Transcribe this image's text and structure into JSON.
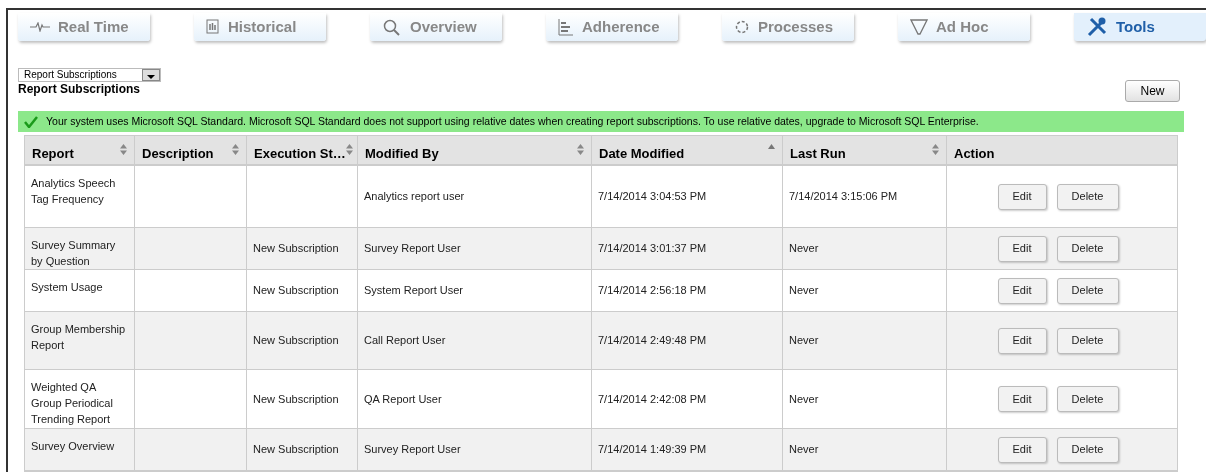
{
  "tabs": [
    {
      "label": "Real Time",
      "selected": false
    },
    {
      "label": "Historical",
      "selected": false
    },
    {
      "label": "Overview",
      "selected": false
    },
    {
      "label": "Adherence",
      "selected": false
    },
    {
      "label": "Processes",
      "selected": false
    },
    {
      "label": "Ad Hoc",
      "selected": false
    },
    {
      "label": "Tools",
      "selected": true
    }
  ],
  "view_select": {
    "value": "Report Subscriptions"
  },
  "page_title": "Report Subscriptions",
  "new_button": "New",
  "banner": {
    "text": "Your system uses Microsoft SQL Standard. Microsoft SQL Standard does not support using relative dates when creating report subscriptions. To use relative dates, upgrade to Microsoft SQL Enterprise."
  },
  "table": {
    "columns": [
      {
        "label": "Report",
        "sortable": true,
        "sorted": false
      },
      {
        "label": "Description",
        "sortable": true,
        "sorted": false
      },
      {
        "label": "Execution St…",
        "sortable": true,
        "sorted": false
      },
      {
        "label": "Modified By",
        "sortable": true,
        "sorted": false
      },
      {
        "label": "Date Modified",
        "sortable": true,
        "sorted": true
      },
      {
        "label": "Last Run",
        "sortable": true,
        "sorted": false
      },
      {
        "label": "Action",
        "sortable": false,
        "sorted": false
      }
    ],
    "rows": [
      {
        "report": "Analytics Speech Tag Frequency",
        "modified_by": "Analytics report user",
        "date_modified": "7/14/2014 3:04:53 PM",
        "last_run": "7/14/2014 3:15:06 PM",
        "actions": [
          "Edit",
          "Delete"
        ]
      },
      {
        "report": "Survey Summary by Question",
        "execution": "New Subscription",
        "modified_by": "Survey Report User",
        "date_modified": "7/14/2014 3:01:37 PM",
        "last_run": "Never",
        "actions": [
          "Edit",
          "Delete"
        ]
      },
      {
        "report": "System Usage",
        "execution": "New Subscription",
        "modified_by": "System Report User",
        "date_modified": "7/14/2014 2:56:18 PM",
        "last_run": "Never",
        "actions": [
          "Edit",
          "Delete"
        ]
      },
      {
        "report": "Group Membership Report",
        "execution": "New Subscription",
        "modified_by": "Call Report User",
        "date_modified": "7/14/2014 2:49:48 PM",
        "last_run": "Never",
        "actions": [
          "Edit",
          "Delete"
        ]
      },
      {
        "report": "Weighted QA Group Periodical Trending Report",
        "execution": "New Subscription",
        "modified_by": "QA Report User",
        "date_modified": "7/14/2014 2:42:08 PM",
        "last_run": "Never",
        "actions": [
          "Edit",
          "Delete"
        ]
      },
      {
        "report": "Survey Overview",
        "execution": "New Subscription",
        "modified_by": "Survey Report User",
        "date_modified": "7/14/2014 1:49:39 PM",
        "last_run": "Never",
        "actions": [
          "Edit",
          "Delete"
        ]
      }
    ]
  }
}
